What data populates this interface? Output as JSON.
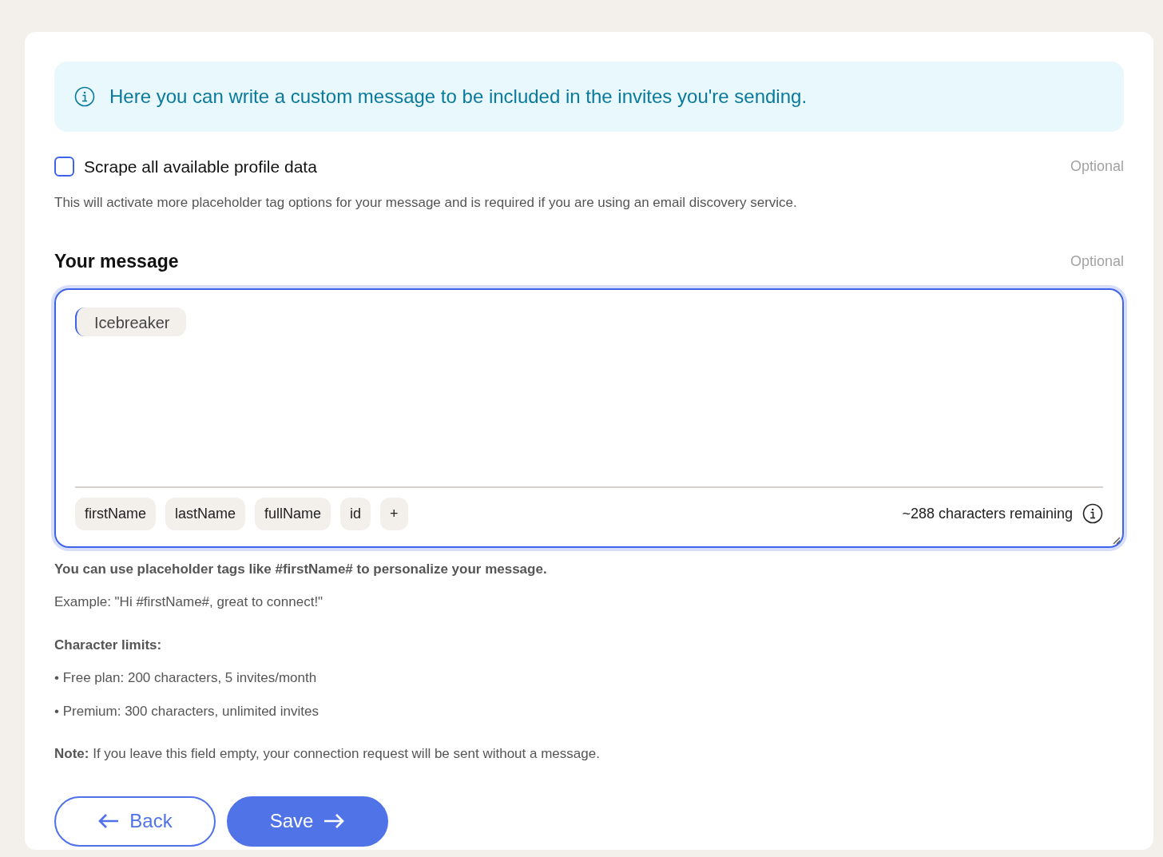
{
  "info_alert": {
    "text": "Here you can write a custom message to be included in the invites you're sending."
  },
  "scrape_option": {
    "label": "Scrape all available profile data",
    "checked": false,
    "optional_label": "Optional",
    "description": "This will activate more placeholder tag options for your message and is required if you are using an email discovery service."
  },
  "message": {
    "title": "Your message",
    "optional_label": "Optional",
    "editor_chips": [
      "Icebreaker"
    ],
    "tags": [
      "firstName",
      "lastName",
      "fullName",
      "id",
      "+"
    ],
    "counter": "~288 characters remaining"
  },
  "help": [
    {
      "kind": "bold",
      "text": "You can use placeholder tags like #firstName# to personalize your message."
    },
    {
      "kind": "plain",
      "text": "Example: \"Hi #firstName#, great to connect!\""
    },
    {
      "kind": "heading",
      "text": "Character limits:"
    },
    {
      "kind": "bullet",
      "text": "• Free plan: 200 characters, 5 invites/month"
    },
    {
      "kind": "bullet",
      "text": "• Premium: 300 characters, unlimited invites"
    },
    {
      "kind": "note",
      "text": "**Note:** If you leave this field empty, your connection request will be sent without a message."
    }
  ],
  "buttons": [
    {
      "label": "Back",
      "kind": "back"
    },
    {
      "label": "Save",
      "kind": "save"
    }
  ]
}
